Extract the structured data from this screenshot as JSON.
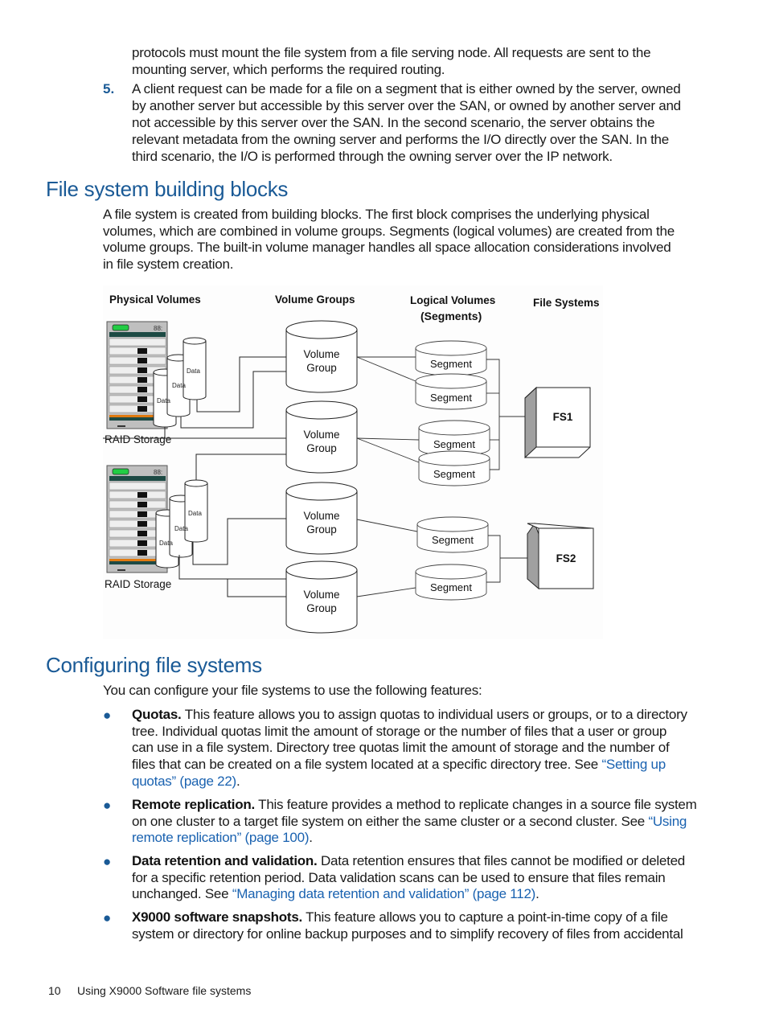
{
  "intro": {
    "continuation_lines": [
      "protocols must mount the file system from a file serving node. All requests are sent to the",
      "mounting server, which performs the required routing."
    ],
    "item5": {
      "number": "5.",
      "lines": [
        "A client request can be made for a file on a segment that is either owned by the server, owned",
        "by another server but accessible by this server over the SAN, or owned by another server and",
        "not accessible by this server over the SAN. In the second scenario, the server obtains the",
        "relevant metadata from the owning server and performs the I/O directly over the SAN. In the",
        "third scenario, the I/O is performed through the owning server over the IP network."
      ]
    }
  },
  "section1": {
    "heading": "File system building blocks",
    "lines": [
      "A file system is created from building blocks. The first block comprises the underlying physical",
      "volumes, which are combined in volume groups. Segments (logical volumes) are created from the",
      "volume groups. The built-in volume manager handles all space allocation considerations involved",
      "in file system creation."
    ]
  },
  "diagram": {
    "col_headers": {
      "physical": "Physical Volumes",
      "groups": "Volume Groups",
      "logical_line1": "Logical Volumes",
      "logical_line2": "(Segments)",
      "fs": "File Systems"
    },
    "raid_label": "RAID Storage",
    "raid_display": "88:",
    "data_label": "Data",
    "vg_line1": "Volume",
    "vg_line2": "Group",
    "segment_label": "Segment",
    "fs1": "FS1",
    "fs2": "FS2"
  },
  "section2": {
    "heading": "Configuring file systems",
    "intro": "You can configure your file systems to use the following features:",
    "bullets": [
      {
        "title": "Quotas.",
        "lines": [
          " This feature allows you to assign quotas to individual users or groups, or to a directory",
          "tree. Individual quotas limit the amount of storage or the number of files that a user or group",
          "can use in a file system. Directory tree quotas limit the amount of storage and the number of",
          "files that can be created on a file system located at a specific directory tree. See "
        ],
        "link_a": "“Setting up",
        "link_b": "quotas” (page 22)",
        "tail": "."
      },
      {
        "title": "Remote replication.",
        "lines": [
          " This feature provides a method to replicate changes in a source file system",
          "on one cluster to a target file system on either the same cluster or a second cluster. See "
        ],
        "link_a": "“Using",
        "link_b": "remote replication” (page 100)",
        "tail": "."
      },
      {
        "title": "Data retention and validation.",
        "lines": [
          " Data retention ensures that files cannot be modified or deleted",
          "for a specific retention period. Data validation scans can be used to ensure that files remain",
          "unchanged. See "
        ],
        "link": "“Managing data retention and validation” (page 112)",
        "tail": "."
      },
      {
        "title": "X9000 software snapshots.",
        "lines": [
          " This feature allows you to capture a point-in-time copy of a file",
          "system or directory for online backup purposes and to simplify recovery of files from accidental"
        ]
      }
    ]
  },
  "footer": {
    "page_number": "10",
    "chapter": "Using X9000 Software file systems"
  }
}
